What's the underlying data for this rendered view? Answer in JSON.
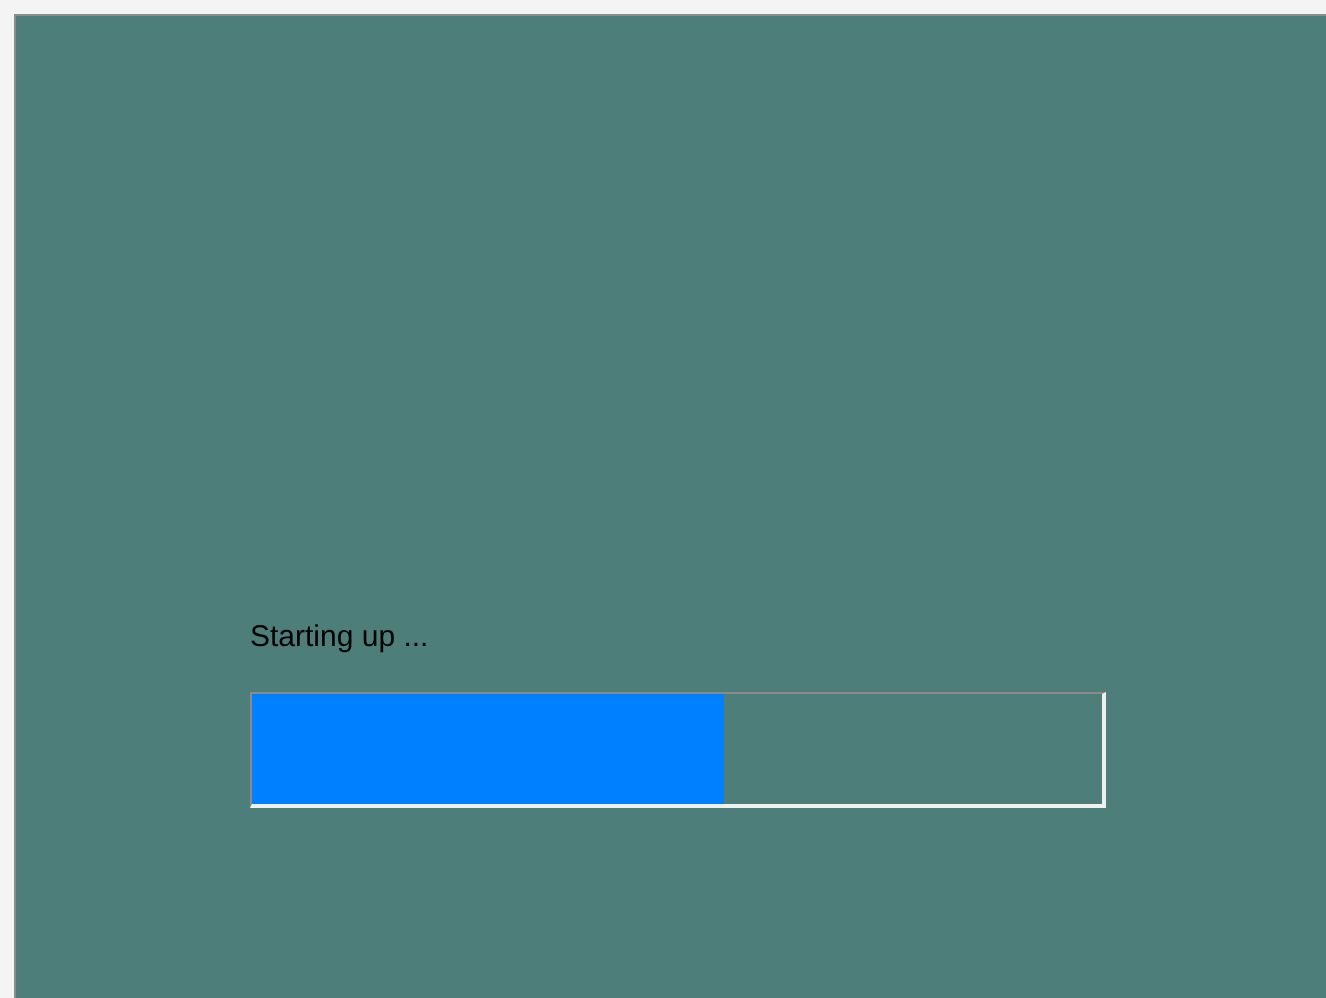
{
  "status": {
    "text": "Starting up ...",
    "progress": {
      "level": 0.555
    }
  }
}
